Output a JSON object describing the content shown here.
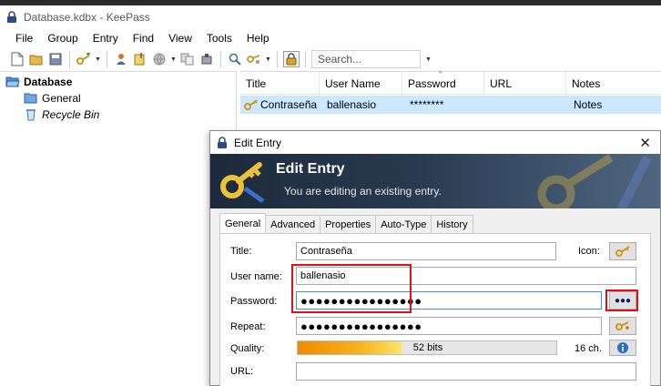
{
  "window": {
    "title": "Database.kdbx - KeePass"
  },
  "menu": [
    "File",
    "Group",
    "Entry",
    "Find",
    "View",
    "Tools",
    "Help"
  ],
  "toolbar": {
    "search_placeholder": "Search..."
  },
  "tree": {
    "root": "Database",
    "children": [
      {
        "label": "General",
        "icon": "folder-icon"
      },
      {
        "label": "Recycle Bin",
        "icon": "recycle-bin-icon"
      }
    ]
  },
  "list": {
    "columns": [
      "Title",
      "User Name",
      "Password",
      "URL",
      "Notes"
    ],
    "rows": [
      {
        "title": "Contraseña",
        "username": "ballenasio",
        "password": "********",
        "url": "",
        "notes": "Notes"
      }
    ]
  },
  "dialog": {
    "title": "Edit Entry",
    "banner_title": "Edit Entry",
    "banner_subtitle": "You are editing an existing entry.",
    "tabs": [
      "General",
      "Advanced",
      "Properties",
      "Auto-Type",
      "History"
    ],
    "active_tab": "General",
    "labels": {
      "title": "Title:",
      "icon": "Icon:",
      "username": "User name:",
      "password": "Password:",
      "repeat": "Repeat:",
      "quality": "Quality:",
      "url": "URL:"
    },
    "values": {
      "title": "Contraseña",
      "username": "ballenasio",
      "password": "●●●●●●●●●●●●●●●●",
      "repeat": "●●●●●●●●●●●●●●●●",
      "url": ""
    },
    "toggle_label": "●●●",
    "quality": {
      "text": "52 bits",
      "fraction": 0.4,
      "chars": "16 ch."
    }
  },
  "colors": {
    "highlight": "#e0101a",
    "selection": "#cce8ff",
    "banner": "#283a4f"
  }
}
